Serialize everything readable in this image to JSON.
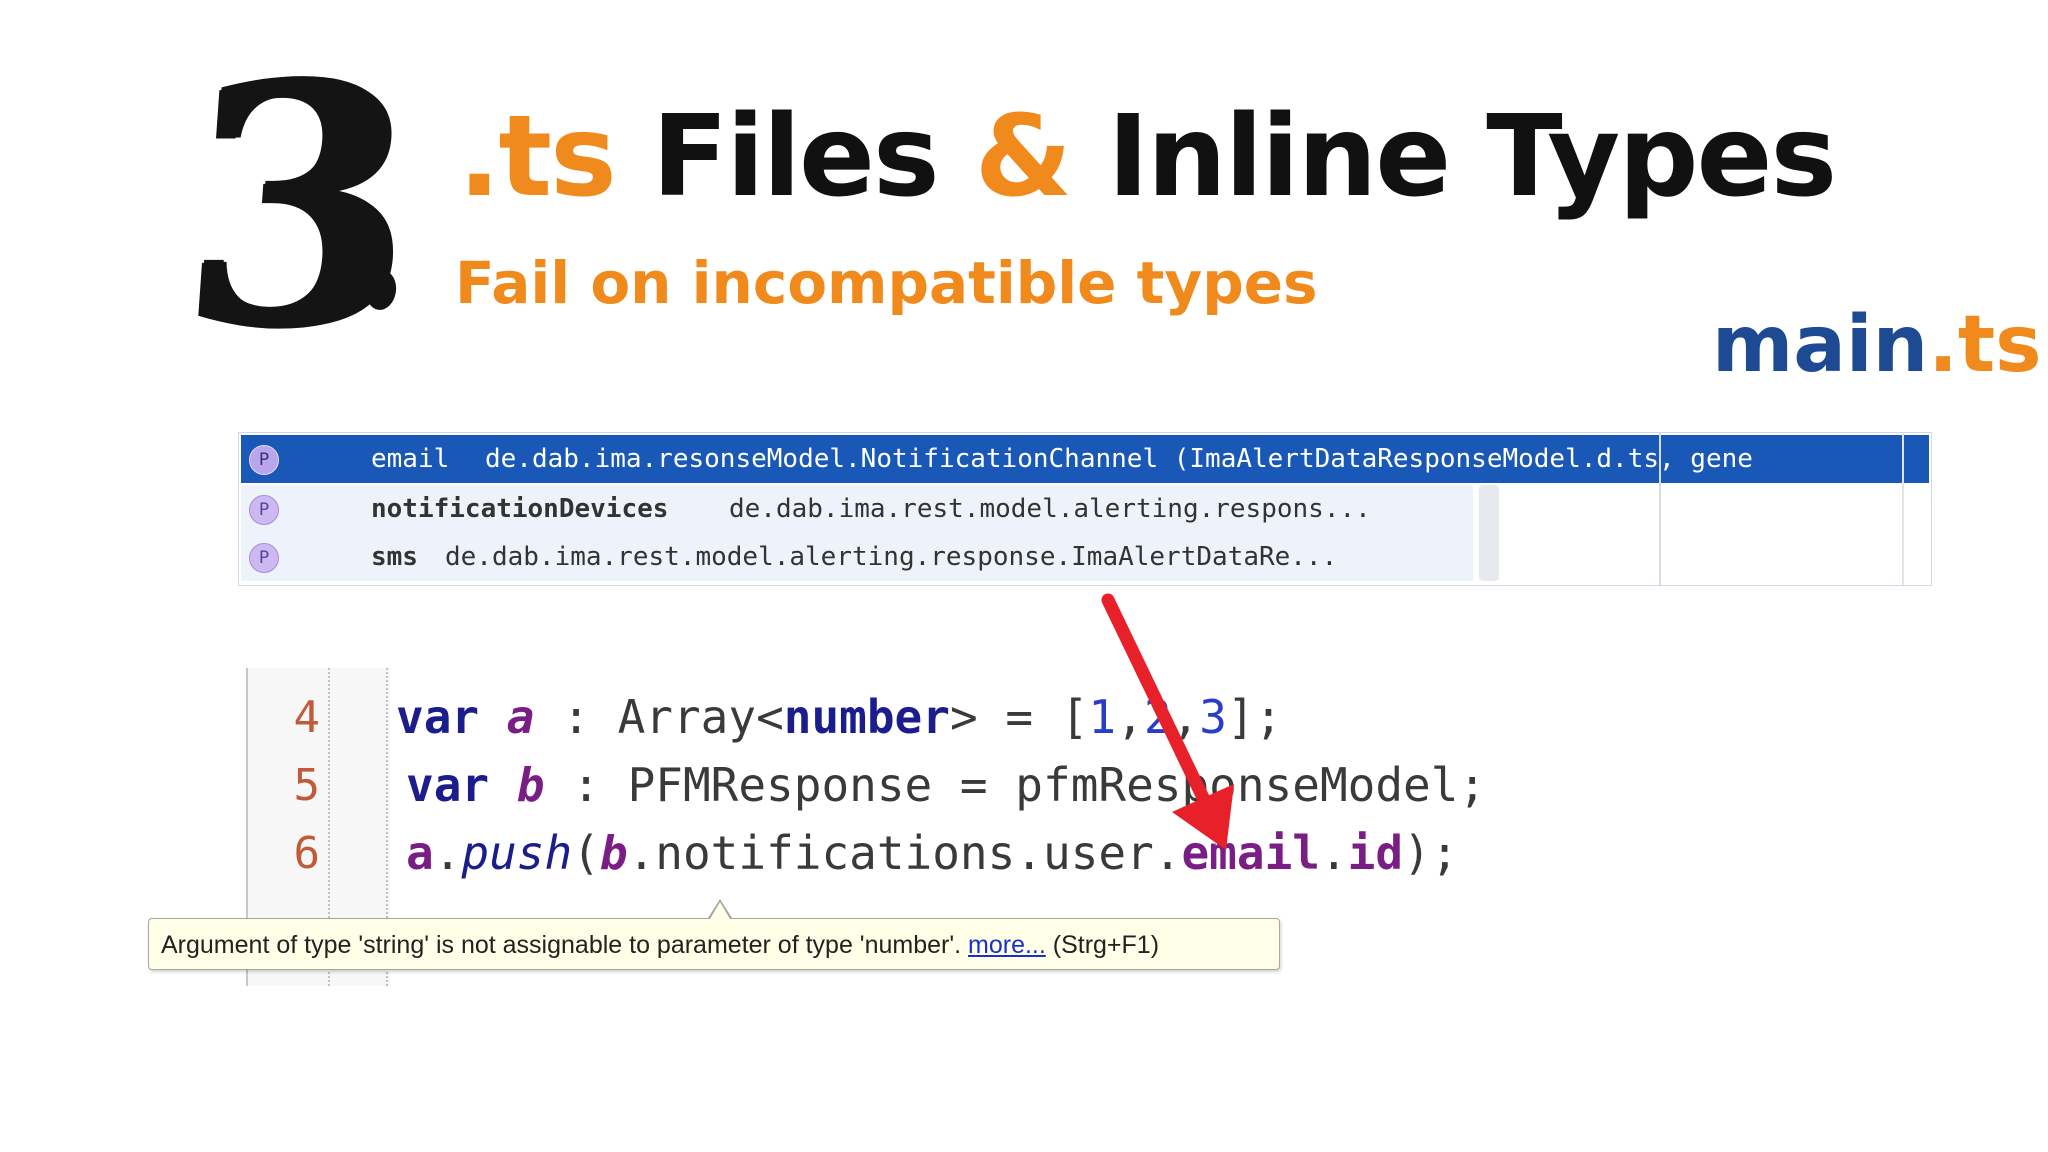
{
  "slide": {
    "number": "3",
    "title_ext": ".ts",
    "title_mid": " Files ",
    "title_amp": "&",
    "title_end": " Inline Types",
    "subtitle": "Fail on incompatible types",
    "file_base": "main",
    "file_ext": ".ts",
    "colors": {
      "orange": "#f08a1c",
      "blue": "#1e4a94"
    }
  },
  "autocomplete": {
    "items": [
      {
        "badge": "P",
        "name": "email",
        "detail": "de.dab.ima.resonseModel.NotificationChannel (ImaAlertDataResponseModel.d.ts, gene"
      },
      {
        "badge": "P",
        "name": "notificationDevices",
        "detail": "de.dab.ima.rest.model.alerting.respons..."
      },
      {
        "badge": "P",
        "name": "sms",
        "detail": "de.dab.ima.rest.model.alerting.response.ImaAlertDataRe..."
      }
    ]
  },
  "editor": {
    "line_numbers": [
      "4",
      "5",
      "6"
    ],
    "line4": {
      "kw": "var",
      "v": "a",
      "sep": " : ",
      "type": "Array<",
      "tkw": "number",
      "rest": "> = [",
      "n1": "1",
      "c1": ",",
      "n2": "2",
      "c2": ",",
      "n3": "3",
      "end": "];"
    },
    "line5": {
      "kw": "var",
      "v": "b",
      "rest": " : PFMResponse = pfmResponseModel;"
    },
    "line6": {
      "v1": "a",
      "dot": ".",
      "fn": "push",
      "open": "(",
      "v2": "b",
      "mid": ".notifications.user.",
      "p1": "email",
      "dot2": ".",
      "p2": "id",
      "end": ");"
    }
  },
  "tooltip": {
    "message": "Argument of type 'string' is not assignable to parameter of type 'number'. ",
    "link": "more...",
    "shortcut": " (Strg+F1)"
  }
}
